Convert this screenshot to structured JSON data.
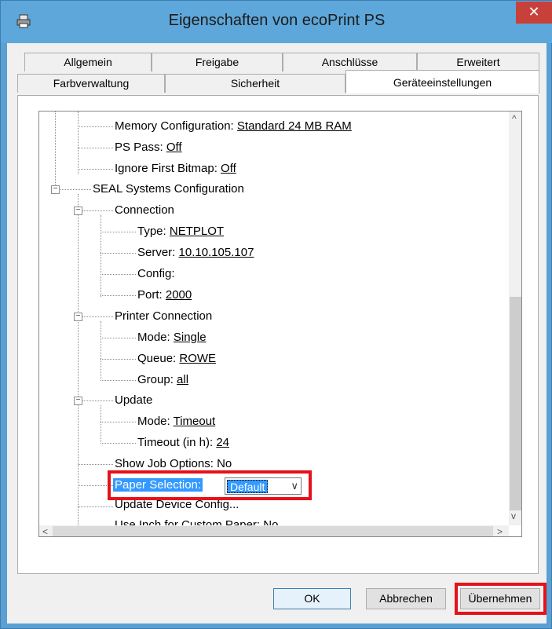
{
  "window": {
    "title": "Eigenschaften von ecoPrint PS",
    "close_label": "✕"
  },
  "tabs_row1": [
    "Allgemein",
    "Freigabe",
    "Anschlüsse",
    "Erweitert"
  ],
  "tabs_row2": [
    "Farbverwaltung",
    "Sicherheit",
    "Geräteeinstellungen"
  ],
  "active_tab": "Geräteeinstellungen",
  "tree": {
    "memory": {
      "label": "Memory Configuration: ",
      "value": "Standard 24 MB RAM"
    },
    "ps_pass": {
      "label": "PS Pass: ",
      "value": "Off"
    },
    "ignore_bitmap": {
      "label": "Ignore First Bitmap: ",
      "value": "Off"
    },
    "seal": {
      "label": "SEAL Systems Configuration"
    },
    "connection": {
      "label": "Connection"
    },
    "type": {
      "label": "Type: ",
      "value": "NETPLOT"
    },
    "server": {
      "label": "Server: ",
      "value": "10.10.105.107"
    },
    "config": {
      "label": "Config:"
    },
    "port": {
      "label": "Port: ",
      "value": "2000"
    },
    "printer_connection": {
      "label": "Printer Connection"
    },
    "mode": {
      "label": "Mode: ",
      "value": "Single"
    },
    "queue": {
      "label": "Queue: ",
      "value": "ROWE"
    },
    "group": {
      "label": "Group: ",
      "value": "all"
    },
    "update": {
      "label": "Update"
    },
    "update_mode": {
      "label": "Mode: ",
      "value": "Timeout"
    },
    "timeout": {
      "label": "Timeout (in h): ",
      "value": "24"
    },
    "show_job": {
      "label": "Show Job Options: No"
    },
    "paper_selection": {
      "label": "Paper Selection:",
      "value": "Default"
    },
    "update_device": {
      "label": "Update Device Config..."
    },
    "use_inch": {
      "label": "Use Inch for Custom Paper: ",
      "value": "No"
    }
  },
  "buttons": {
    "ok": "OK",
    "cancel": "Abbrechen",
    "apply": "Übernehmen"
  },
  "colors": {
    "title_bar": "#5ea7da",
    "close": "#c8403a",
    "selection": "#3399ff",
    "highlight": "#e5121b"
  }
}
